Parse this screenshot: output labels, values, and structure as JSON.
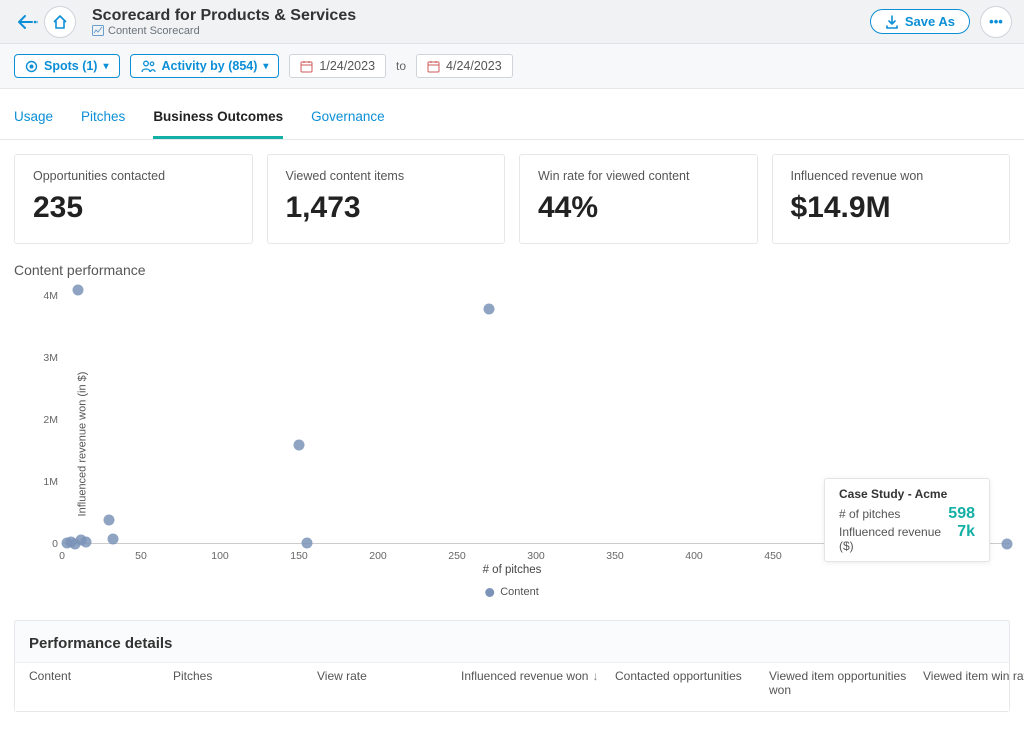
{
  "header": {
    "title": "Scorecard for Products & Services",
    "subtitle": "Content Scorecard",
    "save_as": "Save As"
  },
  "toolbar": {
    "spots_label": "Spots (1)",
    "activity_label": "Activity by (854)",
    "date_from": "1/24/2023",
    "date_to": "4/24/2023",
    "to": "to"
  },
  "tabs": {
    "usage": "Usage",
    "pitches": "Pitches",
    "business": "Business Outcomes",
    "governance": "Governance"
  },
  "kpis": [
    {
      "label": "Opportunities contacted",
      "value": "235"
    },
    {
      "label": "Viewed content items",
      "value": "1,473"
    },
    {
      "label": "Win rate for viewed content",
      "value": "44%"
    },
    {
      "label": "Influenced revenue won",
      "value": "$14.9M"
    }
  ],
  "chart": {
    "title": "Content performance",
    "xlabel": "# of pitches",
    "ylabel": "Influenced revenue won (in $)",
    "legend": "Content"
  },
  "tooltip": {
    "name": "Case Study - Acme",
    "pitches_label": "# of pitches",
    "pitches_val": "598",
    "revenue_label": "Influenced revenue ($)",
    "revenue_val": "7k"
  },
  "details": {
    "title": "Performance details",
    "columns": [
      "Content",
      "Pitches",
      "View rate",
      "Influenced revenue won",
      "Contacted opportunities",
      "Viewed item opportuni­ties won",
      "Viewed item win rate"
    ]
  },
  "chart_data": {
    "type": "scatter",
    "xlabel": "# of pitches",
    "ylabel": "Influenced revenue won (in $)",
    "xlim": [
      0,
      600
    ],
    "ylim": [
      0,
      4200000
    ],
    "xticks": [
      0,
      50,
      100,
      150,
      200,
      250,
      300,
      350,
      400,
      450,
      500,
      550
    ],
    "ytick_labels": [
      "0",
      "1M",
      "2M",
      "3M",
      "4M"
    ],
    "ytick_values": [
      0,
      1000000,
      2000000,
      3000000,
      4000000
    ],
    "series": [
      {
        "name": "Content",
        "points": [
          {
            "x": 10,
            "y": 4100000
          },
          {
            "x": 270,
            "y": 3800000
          },
          {
            "x": 150,
            "y": 1600000
          },
          {
            "x": 30,
            "y": 380000
          },
          {
            "x": 32,
            "y": 80000
          },
          {
            "x": 155,
            "y": 20000
          },
          {
            "x": 3,
            "y": 20000
          },
          {
            "x": 6,
            "y": 40000
          },
          {
            "x": 8,
            "y": 0
          },
          {
            "x": 12,
            "y": 60000
          },
          {
            "x": 15,
            "y": 30000
          },
          {
            "x": 598,
            "y": 7000,
            "label": "Case Study - Acme"
          }
        ]
      }
    ]
  }
}
